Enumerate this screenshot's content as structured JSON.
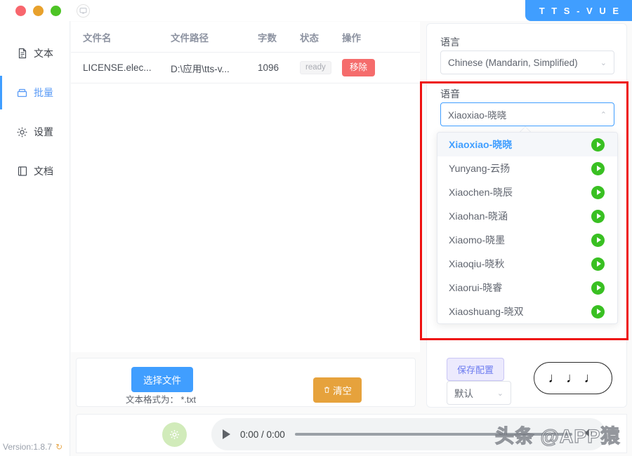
{
  "window": {
    "brand_title": "T T S - V U E",
    "controls": [
      "close-dot",
      "minimize-dot",
      "maximize-dot"
    ],
    "monitor_icon": "monitor-icon"
  },
  "sidebar": {
    "items": [
      {
        "label": "文本",
        "icon": "document-text-icon",
        "active": false
      },
      {
        "label": "批量",
        "icon": "batch-box-icon",
        "active": true
      },
      {
        "label": "设置",
        "icon": "gear-icon",
        "active": false
      },
      {
        "label": "文档",
        "icon": "book-icon",
        "active": false
      }
    ]
  },
  "table": {
    "headers": [
      "文件名",
      "文件路径",
      "字数",
      "状态",
      "操作"
    ],
    "rows": [
      {
        "file_name": "LICENSE.elec...",
        "file_path": "D:\\应用\\tts-v...",
        "word_count": "1096",
        "status": "ready",
        "action_label": "移除"
      }
    ]
  },
  "file_bar": {
    "choose_label": "选择文件",
    "hint": "文本格式为：  *.txt",
    "clear_label": "清空",
    "clear_icon": "trash-icon"
  },
  "settings": {
    "language_label": "语言",
    "language_value": "Chinese (Mandarin, Simplified)",
    "voice_label": "语音",
    "voice_value": "Xiaoxiao-晓晓",
    "save_config_label": "保存配置",
    "preset_value": "默认",
    "notes_button_glyphs": "♩ ♩ ♩",
    "voice_options": [
      {
        "label": "Xiaoxiao-晓晓",
        "selected": true
      },
      {
        "label": "Yunyang-云扬",
        "selected": false
      },
      {
        "label": "Xiaochen-晓辰",
        "selected": false
      },
      {
        "label": "Xiaohan-晓涵",
        "selected": false
      },
      {
        "label": "Xiaomo-晓墨",
        "selected": false
      },
      {
        "label": "Xiaoqiu-晓秋",
        "selected": false
      },
      {
        "label": "Xiaorui-晓睿",
        "selected": false
      },
      {
        "label": "Xiaoshuang-晓双",
        "selected": false
      }
    ]
  },
  "player": {
    "play_icon": "play-icon",
    "time": "0:00 / 0:00",
    "volume_icon": "volume-icon",
    "progress_percent": 0,
    "action_icon": "gear-circle-icon"
  },
  "footer": {
    "version": "Version:1.8.7",
    "refresh_icon": "refresh-icon",
    "watermark": "头条 @APP猿"
  },
  "colors": {
    "accent_blue": "#409EFF",
    "danger_red": "#f56c6c",
    "warning_orange": "#e6a23c",
    "play_green": "#39c022",
    "save_purple": "#6d7cf0",
    "annotation_red": "#ee1111"
  }
}
